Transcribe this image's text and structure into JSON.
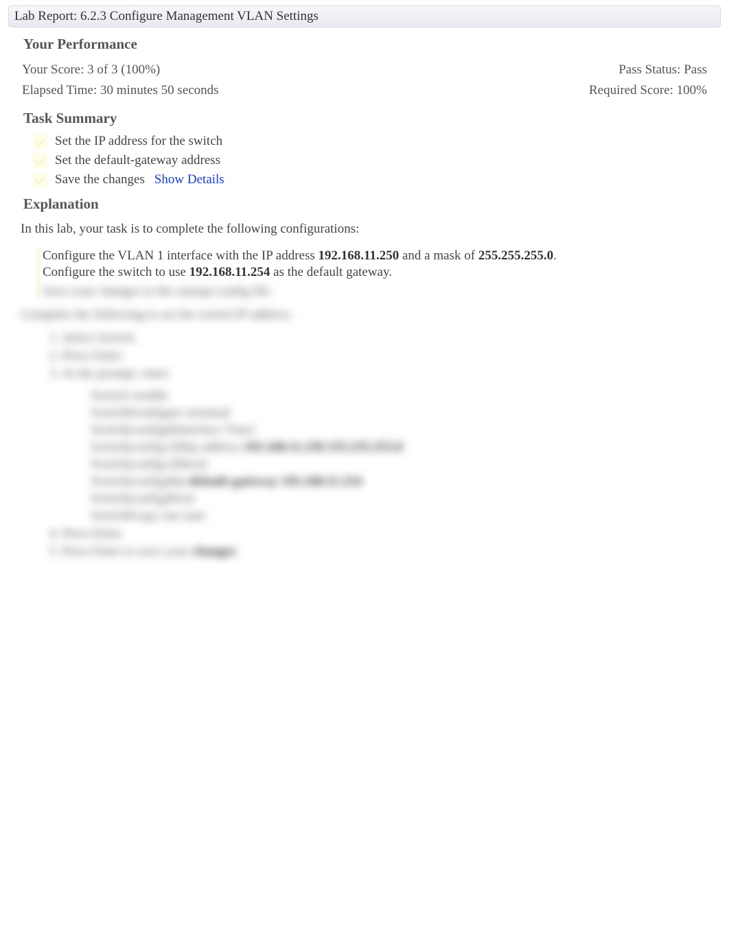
{
  "header": {
    "title": "Lab Report: 6.2.3 Configure Management VLAN Settings"
  },
  "performance": {
    "heading": "Your Performance",
    "score_label": "Your Score: 3 of 3 (100%)",
    "elapsed_label": "Elapsed Time: 30 minutes 50 seconds",
    "pass_status_label": "Pass Status: Pass",
    "required_score_label": "Required Score: 100%"
  },
  "task_summary": {
    "heading": "Task Summary",
    "items": [
      {
        "label": "Set the IP address for the switch"
      },
      {
        "label": "Set the default-gateway address"
      },
      {
        "label": "Save the changes"
      }
    ],
    "show_details": "Show Details"
  },
  "explanation": {
    "heading": "Explanation",
    "intro": "In this lab, your task is to complete the following configurations:",
    "bullets": {
      "line1_pre": "Configure the VLAN 1 interface with the IP address ",
      "line1_ip": "192.168.11.250",
      "line1_mid": " and a mask of ",
      "line1_mask": "255.255.255.0",
      "line1_end": ".",
      "line2_pre": "Configure the switch to use ",
      "line2_ip": "192.168.11.254",
      "line2_end": " as the default gateway.",
      "line3": "Save your changes to the startup-config file."
    }
  },
  "blur": {
    "lead": "Complete the following to set the switch IP address:",
    "steps": {
      "s1": "1. Select Switch.",
      "s2": "2. Press Enter.",
      "s3": "3. At the prompt, enter:"
    },
    "code": {
      "l1": "Switch>enable",
      "l2": "Switch#configure terminal",
      "l3": "Switch(config)#interface Vlan1",
      "l4_pre": "Switch(config-if)#ip address ",
      "l4_b": "192.168.11.250 255.255.255.0",
      "l5": "Switch(config-if)#exit",
      "l6_pre": "Switch(config)#ip ",
      "l6_b": "default-gateway 192.168.11.254",
      "l7": "Switch(config)#exit",
      "l8": "Switch#copy run start"
    },
    "tail": {
      "t1": "4. Press Enter.",
      "t2_pre": "5. Press Enter to save your ",
      "t2_b": "changes",
      "t2_end": "."
    }
  }
}
